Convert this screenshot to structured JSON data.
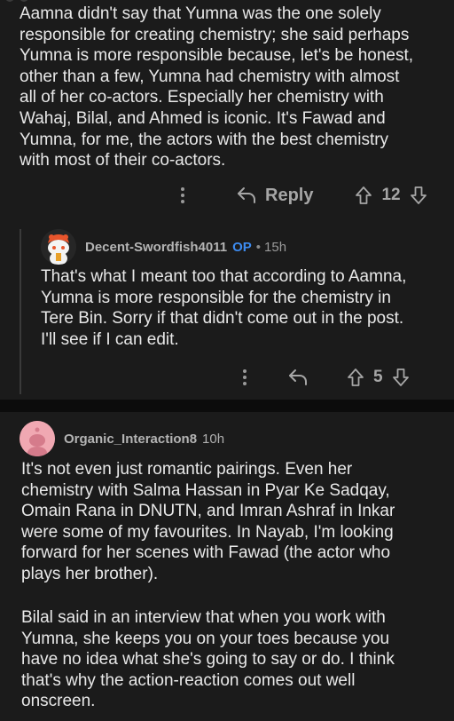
{
  "comments": [
    {
      "body": "Aamna didn't say that Yumna was the one solely\nresponsible for creating chemistry; she said perhaps\nYumna is more responsible because, let's be honest,\nother than a few, Yumna had chemistry with almost\nall of her co-actors. Especially her chemistry with\nWahaj, Bilal, and Ahmed is iconic. It's Fawad and\nYumna, for me, the actors with the best chemistry\nwith most of their co-actors.",
      "reply_label": "Reply",
      "votes": "12"
    },
    {
      "username": "Decent-Swordfish4011",
      "badge": "OP",
      "bullet": "•",
      "time": "15h",
      "body": "That's what I meant too that according to Aamna,\nYumna is more responsible for the chemistry in\nTere Bin. Sorry if that didn't come out in the post.\nI'll see if I can edit.",
      "votes": "5"
    },
    {
      "username": "Organic_Interaction8",
      "time": "10h",
      "body_p1": "It's not even just romantic pairings. Even her\nchemistry with Salma Hassan in Pyar Ke Sadqay,\nOmain Rana in DNUTN, and Imran Ashraf in Inkar\nwere some of my favourites. In Nayab, I'm looking\nforward for her scenes with Fawad (the actor who\nplays her brother).",
      "body_p2": "Bilal said in an interview that when you work with\nYumna, she keeps you on your toes because you\nhave no idea what she's going to say or do. I think\nthat's why the action-reaction comes out well\nonscreen."
    }
  ],
  "colors": {
    "background": "#1b1b1b",
    "op_badge": "#3d8bf0",
    "muted_text": "#a6a6a6",
    "avatar_pink": "#f0a8b2"
  },
  "icons": [
    "more-options-icon",
    "reply-arrow-icon",
    "upvote-arrow-icon",
    "downvote-arrow-icon",
    "snoo-avatar-icon",
    "default-avatar-icon"
  ]
}
